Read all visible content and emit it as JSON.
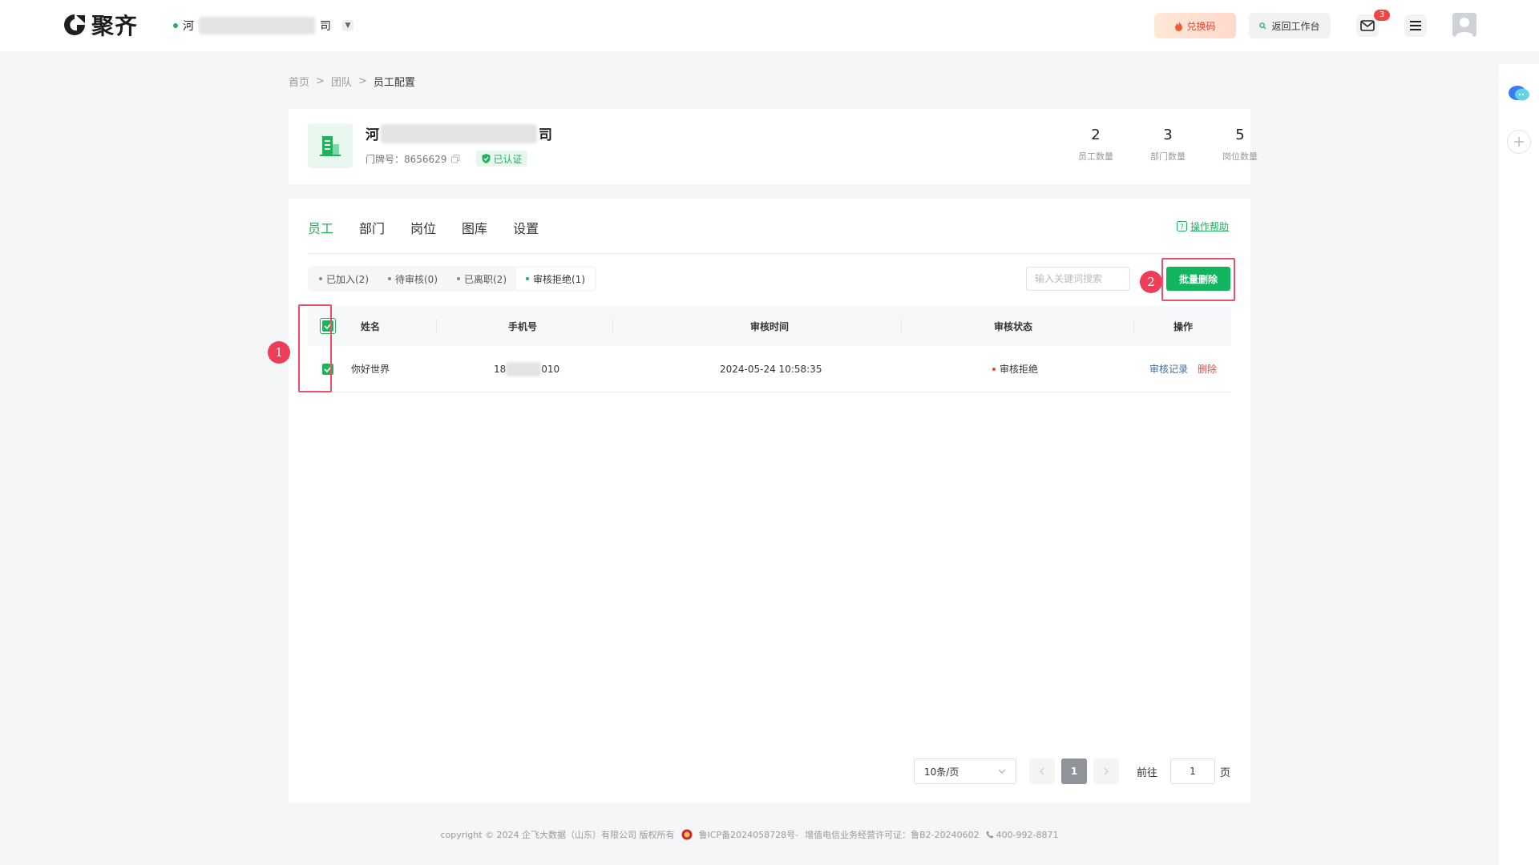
{
  "header": {
    "logo_text": "聚齐",
    "org_prefix": "河",
    "org_suffix": "司",
    "redeem_label": "兑换码",
    "back_label": "返回工作台",
    "mail_badge": "3"
  },
  "breadcrumb": {
    "home": "首页",
    "team": "团队",
    "current": "员工配置",
    "separator": ">"
  },
  "company": {
    "name_prefix": "河",
    "name_suffix": "司",
    "door_label": "门牌号：8656629",
    "verified": "已认证",
    "stats": [
      {
        "num": "2",
        "label": "员工数量"
      },
      {
        "num": "3",
        "label": "部门数量"
      },
      {
        "num": "5",
        "label": "岗位数量"
      }
    ]
  },
  "tabs": [
    "员工",
    "部门",
    "岗位",
    "图库",
    "设置"
  ],
  "help": "操作帮助",
  "filters": [
    "已加入(2)",
    "待审核(0)",
    "已离职(2)",
    "审核拒绝(1)"
  ],
  "search": {
    "placeholder": "输入关键词搜索"
  },
  "bulk_delete": "批量删除",
  "callouts": [
    "1",
    "2"
  ],
  "table": {
    "headers": [
      "姓名",
      "手机号",
      "审核时间",
      "审核状态",
      "操作"
    ],
    "rows": [
      {
        "name": "你好世界",
        "phone_prefix": "18",
        "phone_suffix": "010",
        "time": "2024-05-24 10:58:35",
        "status": "审核拒绝",
        "action_record": "审核记录",
        "action_delete": "删除"
      }
    ]
  },
  "pagination": {
    "page_size": "10条/页",
    "current": "1",
    "goto_label": "前往",
    "goto_value": "1",
    "page_unit": "页"
  },
  "footer": {
    "copyright": "copyright © 2024 企飞大数据（山东）有限公司 版权所有",
    "icp": "鲁ICP备2024058728号-",
    "license": "增值电信业务经营许可证：鲁B2-20240602",
    "phone": "400-992-8871"
  },
  "colors": {
    "accent": "#20b15a",
    "danger": "#f04545",
    "highlight": "#e9506a"
  }
}
